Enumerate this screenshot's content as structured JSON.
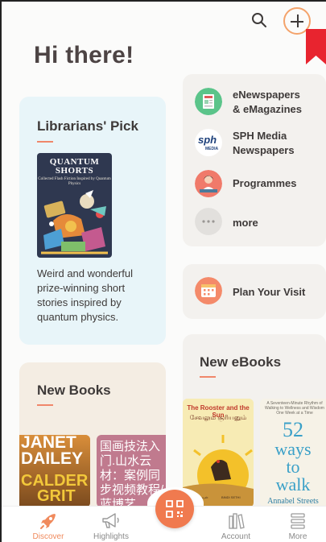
{
  "header": {
    "greeting": "Hi there!"
  },
  "librarians_pick": {
    "title": "Librarians' Pick",
    "cover_title": "QUANTUM SHORTS",
    "cover_subtitle": "Collected Flash Fiction Inspired by Quantum Physics",
    "description": "Weird and wonderful prize-winning short stories inspired by quantum physics."
  },
  "menu": {
    "items": [
      {
        "label_line1": "eNewspapers",
        "label_line2": "& eMagazines",
        "icon": "newspaper-icon",
        "color": "#5bc48a"
      },
      {
        "label_line1": "SPH Media",
        "label_line2": "Newspapers",
        "icon": "sph-logo-icon",
        "color": "#ffffff"
      },
      {
        "label_line1": "Programmes",
        "label_line2": "",
        "icon": "presenter-icon",
        "color": "#f07a6a"
      },
      {
        "label_line1": "more",
        "label_line2": "",
        "icon": "more-dots-icon",
        "color": "#e2e0dd"
      }
    ],
    "sph_logo_text": "sph",
    "sph_logo_sub": "MEDIA"
  },
  "visit": {
    "label": "Plan Your Visit",
    "icon": "calendar-icon",
    "color": "#f48a6a"
  },
  "new_books": {
    "title": "New Books",
    "covers": [
      {
        "line1": "JANET",
        "line2": "DAILEY",
        "line3": "CALDER",
        "line4": "GRIT"
      },
      {
        "text": "国画技法入门.山水云材：案例同步视频教程/蓝博艺"
      }
    ]
  },
  "new_ebooks": {
    "title": "New eBooks",
    "covers": [
      {
        "title": "The Rooster and the Sun",
        "tamil": "சேவலும் சூரியனும்",
        "author": "அகிலா கேசவன்",
        "illustrator": "BINDI SETHI"
      },
      {
        "top": "A Seventeen-Minute Rhythm of Walking to Wellness and Wisdom One Week at a Time",
        "n": "52",
        "w1": "ways",
        "w2": "to",
        "w3": "walk",
        "author": "Annabel Streets"
      }
    ]
  },
  "navbar": {
    "items": [
      {
        "label": "Discover",
        "icon": "rocket-icon",
        "active": true
      },
      {
        "label": "Highlights",
        "icon": "megaphone-icon",
        "active": false
      },
      {
        "label": "Account",
        "icon": "books-icon",
        "active": false
      },
      {
        "label": "More",
        "icon": "list-icon",
        "active": false
      }
    ],
    "qr_icon": "qr-code-icon"
  },
  "colors": {
    "accent": "#f07a4f",
    "text": "#3e3a39",
    "bookmark": "#e8242f"
  }
}
